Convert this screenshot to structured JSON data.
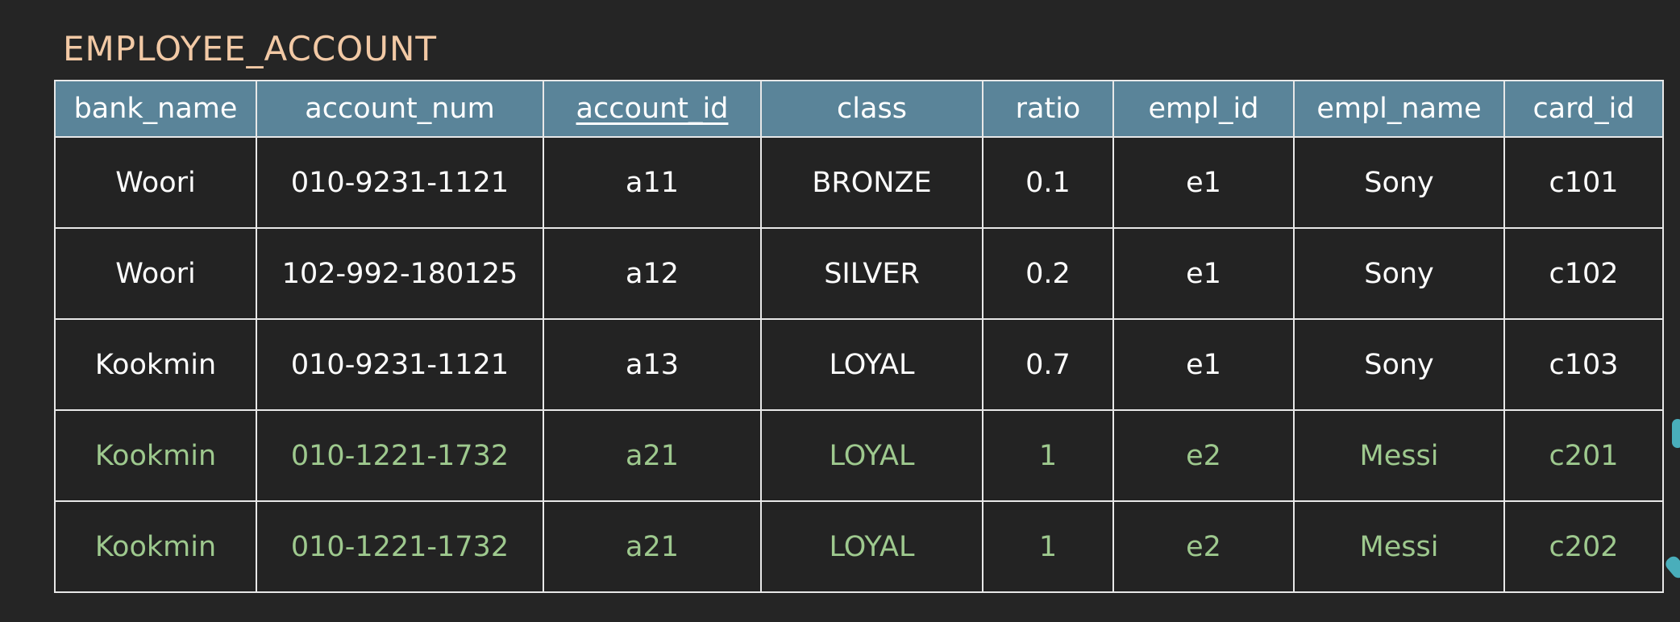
{
  "title": "EMPLOYEE_ACCOUNT",
  "columns": [
    {
      "label": "bank_name",
      "key": false
    },
    {
      "label": "account_num",
      "key": false
    },
    {
      "label": "account_id",
      "key": true
    },
    {
      "label": "class",
      "key": false
    },
    {
      "label": "ratio",
      "key": false
    },
    {
      "label": "empl_id",
      "key": false
    },
    {
      "label": "empl_name",
      "key": false
    },
    {
      "label": "card_id",
      "key": false
    }
  ],
  "rows": [
    {
      "highlight": false,
      "cells": [
        "Woori",
        "010-9231-1121",
        "a11",
        "BRONZE",
        "0.1",
        "e1",
        "Sony",
        "c101"
      ]
    },
    {
      "highlight": false,
      "cells": [
        "Woori",
        "102-992-180125",
        "a12",
        "SILVER",
        "0.2",
        "e1",
        "Sony",
        "c102"
      ]
    },
    {
      "highlight": false,
      "cells": [
        "Kookmin",
        "010-9231-1121",
        "a13",
        "LOYAL",
        "0.7",
        "e1",
        "Sony",
        "c103"
      ]
    },
    {
      "highlight": true,
      "cells": [
        "Kookmin",
        "010-1221-1732",
        "a21",
        "LOYAL",
        "1",
        "e2",
        "Messi",
        "c201"
      ]
    },
    {
      "highlight": true,
      "cells": [
        "Kookmin",
        "010-1221-1732",
        "a21",
        "LOYAL",
        "1",
        "e2",
        "Messi",
        "c202"
      ]
    }
  ],
  "colors": {
    "background": "#252525",
    "title": "#f2c9a5",
    "header_bg": "#5a8499",
    "normal_text": "#ffffff",
    "highlight_text": "#9ec98e"
  }
}
